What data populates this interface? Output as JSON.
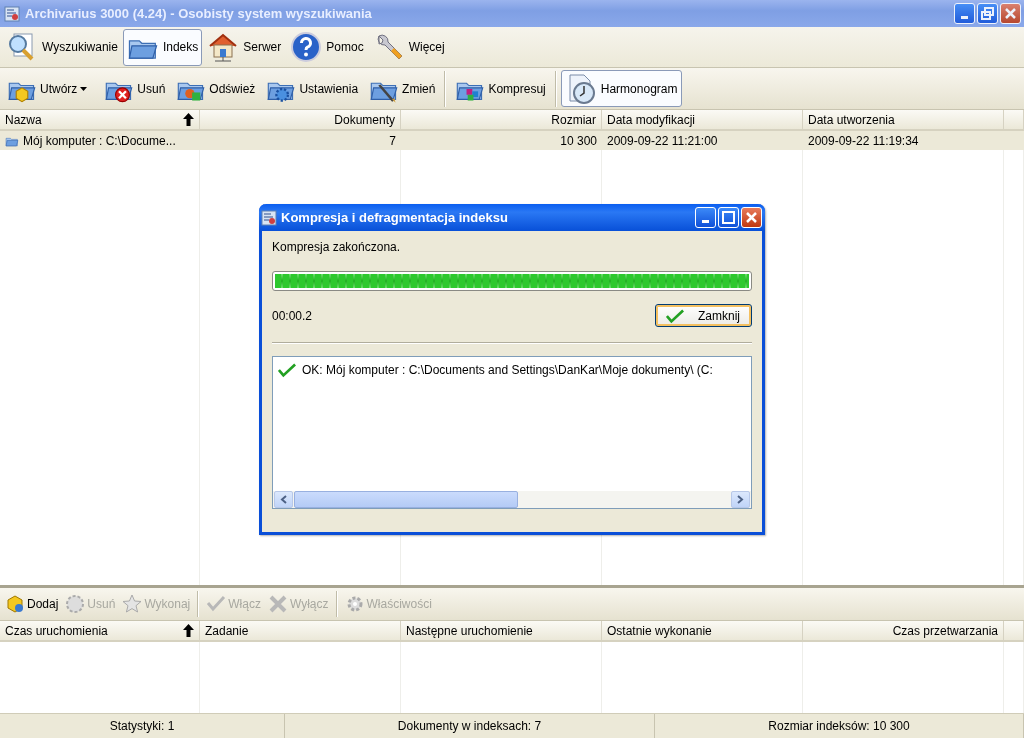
{
  "window": {
    "title": "Archivarius 3000 (4.24) - Osobisty system wyszukiwania"
  },
  "main_tabs": [
    {
      "label": "Wyszukiwanie",
      "selected": false
    },
    {
      "label": "Indeks",
      "selected": true
    },
    {
      "label": "Serwer",
      "selected": false
    },
    {
      "label": "Pomoc",
      "selected": false
    },
    {
      "label": "Więcej",
      "selected": false
    }
  ],
  "index_toolbar": [
    {
      "kind": "dropdown",
      "label": "Utwórz",
      "selected": false
    },
    {
      "kind": "button",
      "label": "Usuń",
      "selected": false
    },
    {
      "kind": "button",
      "label": "Odśwież",
      "selected": false
    },
    {
      "kind": "button",
      "label": "Ustawienia",
      "selected": false
    },
    {
      "kind": "button",
      "label": "Zmień",
      "selected": false
    },
    {
      "kind": "separator"
    },
    {
      "kind": "button",
      "label": "Kompresuj",
      "selected": false
    },
    {
      "kind": "separator"
    },
    {
      "kind": "button",
      "label": "Harmonogram",
      "selected": true
    }
  ],
  "index_table": {
    "columns": [
      {
        "label": "Nazwa",
        "sorted": true
      },
      {
        "label": "Dokumenty",
        "sorted": false
      },
      {
        "label": "Rozmiar",
        "sorted": false
      },
      {
        "label": "Data modyfikacji",
        "sorted": false
      },
      {
        "label": "Data utworzenia",
        "sorted": false
      }
    ],
    "rows": [
      {
        "selected": true,
        "cells": [
          "Mój komputer : C:\\Docume...",
          "7",
          "10 300",
          "2009-09-22 11:21:00",
          "2009-09-22 11:19:34"
        ]
      }
    ]
  },
  "dialog": {
    "title": "Kompresja i defragmentacja indeksu",
    "message": "Kompresja zakończona.",
    "progress": {
      "level": 1
    },
    "elapsed": "00:00.2",
    "close_button": "Zamknij",
    "log": [
      {
        "kind": "ok",
        "text": "OK: Mój komputer : C:\\Documents and Settings\\DanKar\\Moje dokumenty\\ (C:"
      }
    ]
  },
  "schedule_toolbar": [
    {
      "kind": "button",
      "label": "Dodaj",
      "disabled": false
    },
    {
      "kind": "button",
      "label": "Usuń",
      "disabled": true
    },
    {
      "kind": "button",
      "label": "Wykonaj",
      "disabled": true
    },
    {
      "kind": "separator"
    },
    {
      "kind": "button",
      "label": "Włącz",
      "disabled": true
    },
    {
      "kind": "button",
      "label": "Wyłącz",
      "disabled": true
    },
    {
      "kind": "separator"
    },
    {
      "kind": "button",
      "label": "Właściwości",
      "disabled": true
    }
  ],
  "schedule_table": {
    "columns": [
      {
        "label": "Czas uruchomienia",
        "sorted": true
      },
      {
        "label": "Zadanie",
        "sorted": false
      },
      {
        "label": "Następne uruchomienie",
        "sorted": false
      },
      {
        "label": "Ostatnie wykonanie",
        "sorted": false
      },
      {
        "label": "Czas przetwarzania",
        "sorted": false
      }
    ]
  },
  "status_bar": [
    "Statystyki: 1",
    "Dokumenty w indeksach: 7",
    "Rozmiar indeksów: 10 300"
  ]
}
